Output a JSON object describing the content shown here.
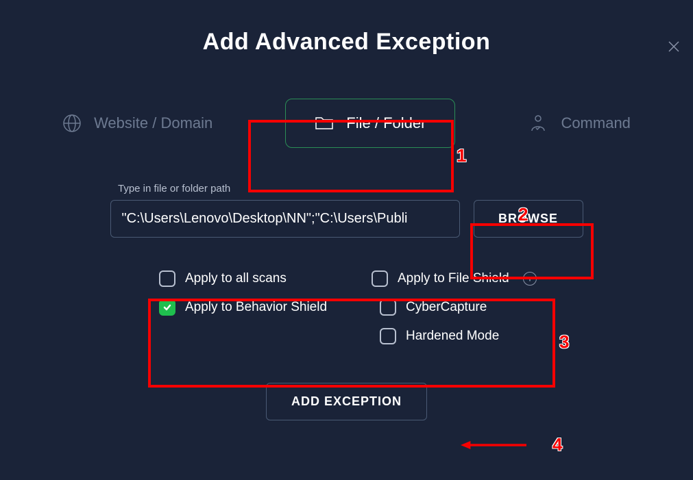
{
  "title": "Add Advanced Exception",
  "tabs": {
    "website": "Website / Domain",
    "file_folder": "File / Folder",
    "command": "Command"
  },
  "input": {
    "label": "Type in file or folder path",
    "value": "\"C:\\Users\\Lenovo\\Desktop\\NN\";\"C:\\Users\\Publi"
  },
  "buttons": {
    "browse": "BROWSE",
    "add": "ADD EXCEPTION"
  },
  "checkboxes": {
    "all_scans": "Apply to all scans",
    "file_shield": "Apply to File Shield",
    "behavior_shield": "Apply to Behavior Shield",
    "cybercapture": "CyberCapture",
    "hardened_mode": "Hardened Mode"
  },
  "annotations": {
    "step1": "1",
    "step2": "2",
    "step3": "3",
    "step4": "4"
  }
}
